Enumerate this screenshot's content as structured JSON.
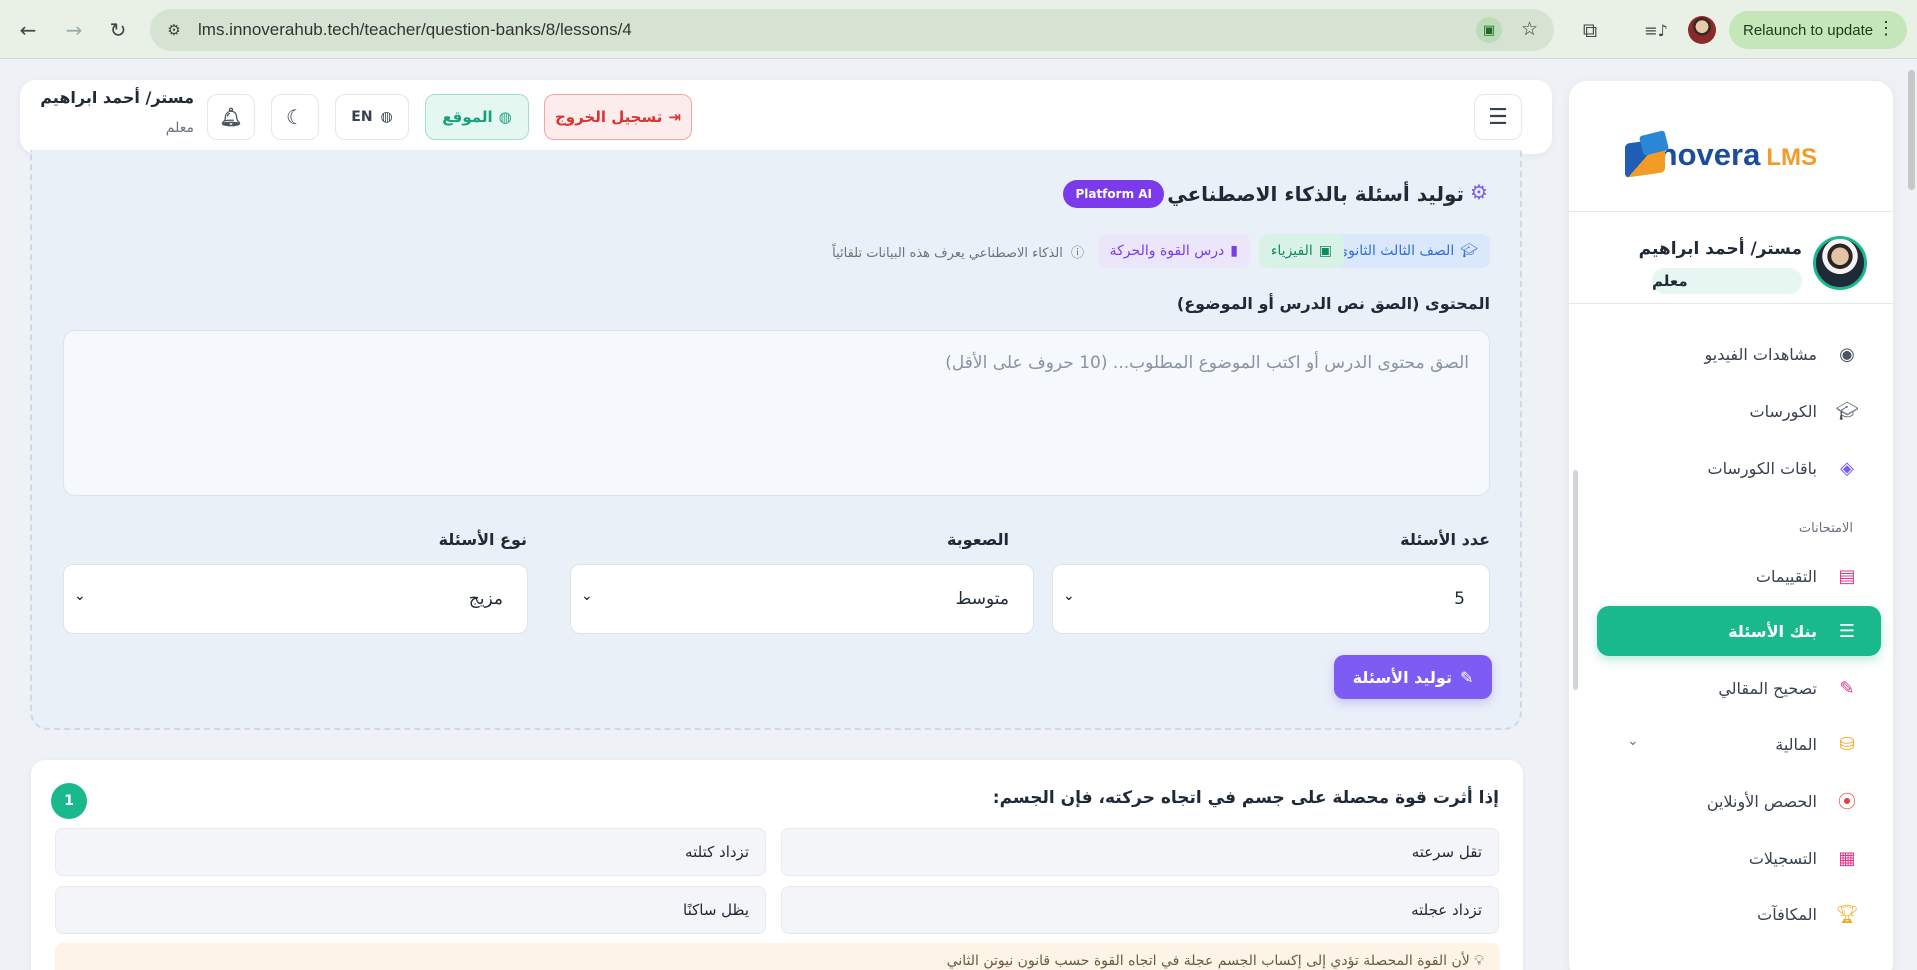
{
  "browser": {
    "url": "lms.innoverahub.tech/teacher/question-banks/8/lessons/4",
    "relaunch_label": "Relaunch to update"
  },
  "header": {
    "logout_label": "تسجيل الخروج",
    "site_label": "الموقع",
    "lang_label": "EN",
    "user_name": "مستر/ أحمد ابراهيم",
    "user_role": "معلم"
  },
  "sidebar": {
    "logo_text": "Innovera",
    "logo_suffix": "LMS",
    "profile_name": "مستر/ أحمد ابراهيم",
    "profile_role": "معلم",
    "section_exams": "الامتحانات",
    "items": [
      {
        "label": "مشاهدات الفيديو",
        "icon": "eye-icon"
      },
      {
        "label": "الكورسات",
        "icon": "graduation-cap-icon"
      },
      {
        "label": "باقات الكورسات",
        "icon": "layers-icon"
      },
      {
        "label": "التقييمات",
        "icon": "clipboard-icon"
      },
      {
        "label": "بنك الأسئلة",
        "icon": "database-icon",
        "active": true
      },
      {
        "label": "تصحيح المقالي",
        "icon": "pen-icon"
      },
      {
        "label": "المالية",
        "icon": "coins-icon"
      },
      {
        "label": "الحصص الأونلاين",
        "icon": "broadcast-icon"
      },
      {
        "label": "التسجيلات",
        "icon": "film-icon"
      },
      {
        "label": "المكافآت",
        "icon": "trophy-icon"
      }
    ]
  },
  "ai": {
    "title": "توليد أسئلة بالذكاء الاصطناعي",
    "badge": "Platform AI",
    "tags": {
      "grade": "الصف الثالث الثانوي",
      "subject": "الفيزياء",
      "lesson": "درس القوة والحركة",
      "note": "الذكاء الاصطناعي يعرف هذه البيانات تلقائياً"
    },
    "content_label": "المحتوى (الصق نص الدرس أو الموضوع)",
    "content_placeholder": "الصق محتوى الدرس أو اكتب الموضوع المطلوب... (10 حروف على الأقل)",
    "count_label": "عدد الأسئلة",
    "count_value": "5",
    "difficulty_label": "الصعوبة",
    "difficulty_value": "متوسط",
    "type_label": "نوع الأسئلة",
    "type_value": "مزيج",
    "generate_label": "توليد الأسئلة"
  },
  "question": {
    "number": "1",
    "text": "إذا أثرت قوة محصلة على جسم في اتجاه حركته، فإن الجسم:",
    "options": [
      "تقل سرعته",
      "تزداد كتلته",
      "تزداد عجلته",
      "يظل ساكنًا"
    ],
    "explanation": "لأن القوة المحصلة تؤدي إلى إكساب الجسم عجلة في اتجاه القوة حسب قانون نيوتن الثاني"
  },
  "colors": {
    "accent": "#19b98d",
    "ai_purple": "#7c5cf2",
    "danger": "#d93434"
  }
}
